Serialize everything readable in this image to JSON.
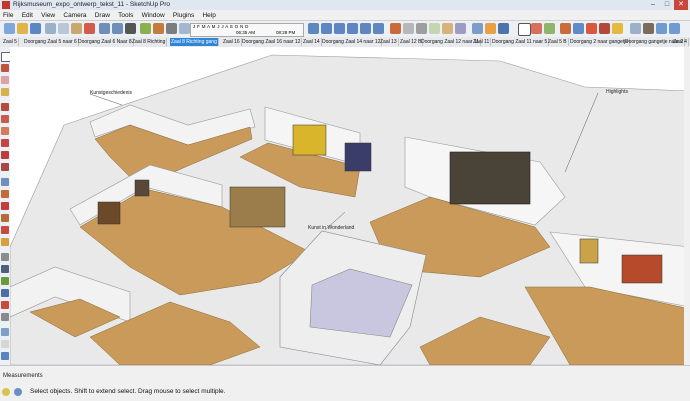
{
  "window": {
    "title": "Rijksmuseum_expo_ontwerp_tekst_11 - SketchUp Pro",
    "minimize": "–",
    "maximize": "□",
    "close": "✕"
  },
  "menu": [
    "File",
    "Edit",
    "View",
    "Camera",
    "Draw",
    "Tools",
    "Window",
    "Plugins",
    "Help"
  ],
  "shadow_settings": {
    "months": "J F M A M J J A S O N D",
    "time_start": "06:35 AM",
    "time_end": "08:28 PM"
  },
  "scenes": [
    "Zaal 5",
    "Doorgang Zaal 5 naar 6",
    "Doorgang Zaal 6 Naar 8",
    "Zaal 8 Richting",
    "Zaal 8 Richting gang",
    "Zaal 16",
    "Doorgang Zaal 16 naar 12",
    "Zaal 14",
    "Doorgang Zaal 14 naar 12",
    "Zaal 13",
    "Zaal 12 B",
    "Doorgang Zaal 12 naar 11",
    "Zaal 11",
    "Doorgang Zaal 11 naar 5",
    "Zaal 5 B",
    "Doorgang 2 naar gangetje",
    "Doorgang gangetje naar 2",
    "Zaal 4"
  ],
  "active_scene_index": 4,
  "viewport_labels": {
    "label_kunst": "Kunstgeschiedenis",
    "label_highlights": "Highlights",
    "label_wonderland": "Kunst in Wonderland"
  },
  "status": {
    "label": "Measurements",
    "message": "Select objects. Shift to extend select. Drag mouse to select multiple."
  },
  "colors": {
    "floor": "#c99a5a",
    "wall": "#f1f1f1",
    "wall_shade": "#b9b9b9",
    "courtyard": "#c9c7df",
    "active_tab": "#2f86d6"
  }
}
